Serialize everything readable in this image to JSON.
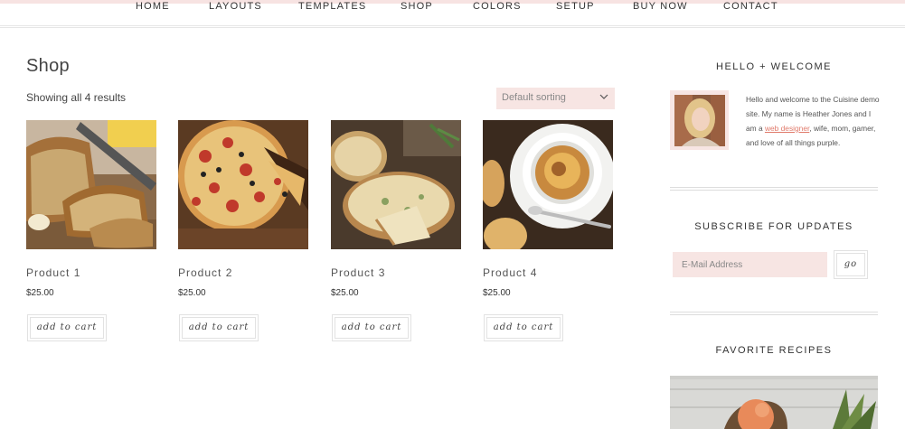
{
  "nav": {
    "items": [
      "HOME",
      "LAYOUTS",
      "TEMPLATES",
      "SHOP",
      "COLORS",
      "SETUP",
      "BUY NOW",
      "CONTACT"
    ]
  },
  "shop": {
    "title": "Shop",
    "result_count": "Showing all 4 results",
    "sorting": "Default sorting",
    "products": [
      {
        "name": "Product 1",
        "price": "$25.00",
        "button": "add to cart",
        "image": "banana-bread-photo"
      },
      {
        "name": "Product 2",
        "price": "$25.00",
        "button": "add to cart",
        "image": "pizza-photo"
      },
      {
        "name": "Product 3",
        "price": "$25.00",
        "button": "add to cart",
        "image": "quiche-photo"
      },
      {
        "name": "Product 4",
        "price": "$25.00",
        "button": "add to cart",
        "image": "onion-soup-photo"
      }
    ]
  },
  "sidebar": {
    "welcome": {
      "title": "HELLO + WELCOME",
      "text_before": "Hello and welcome to the Cuisine demo site. My name is Heather Jones and I am a ",
      "link": "web designer",
      "text_after": ", wife, mom, gamer, and love of all things purple."
    },
    "subscribe": {
      "title": "SUBSCRIBE FOR UPDATES",
      "placeholder": "E-Mail Address",
      "button": "go"
    },
    "recipes": {
      "title": "FAVORITE RECIPES"
    }
  },
  "colors": {
    "accent_pink": "#f7e5e3",
    "link": "#e07a6b",
    "text": "#555555"
  }
}
